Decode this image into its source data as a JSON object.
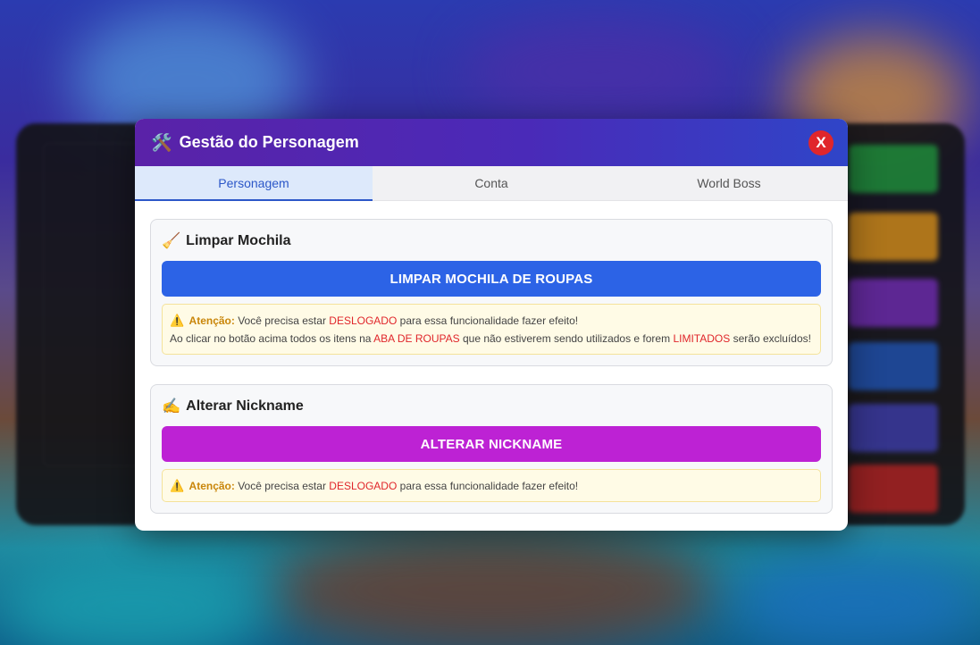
{
  "modal": {
    "title": "Gestão do Personagem",
    "title_icon": "tools-icon",
    "close_label": "X"
  },
  "tabs": [
    {
      "label": "Personagem",
      "active": true
    },
    {
      "label": "Conta",
      "active": false
    },
    {
      "label": "World Boss",
      "active": false
    }
  ],
  "sections": {
    "mochila": {
      "title": "Limpar Mochila",
      "icon": "broom-icon",
      "button": "LIMPAR MOCHILA DE ROUPAS",
      "warning": {
        "label": "Atenção:",
        "line1_a": "Você precisa estar",
        "line1_hl": "DESLOGADO",
        "line1_b": "para essa funcionalidade fazer efeito!",
        "line2_a": "Ao clicar no botão acima todos os itens na",
        "line2_hl1": "ABA DE ROUPAS",
        "line2_b": "que não estiverem sendo utilizados e forem",
        "line2_hl2": "LIMITADOS",
        "line2_c": "serão excluídos!"
      }
    },
    "nickname": {
      "title": "Alterar Nickname",
      "icon": "writing-hand-icon",
      "button": "ALTERAR NICKNAME",
      "warning": {
        "label": "Atenção:",
        "line1_a": "Você precisa estar",
        "line1_hl": "DESLOGADO",
        "line1_b": "para essa funcionalidade fazer efeito!"
      }
    }
  },
  "colors": {
    "header_start": "#5a22a8",
    "header_end": "#2f45c8",
    "primary_button": "#2c63e6",
    "nickname_button": "#bd22d4",
    "close_button": "#e0262b",
    "highlight": "#e0262b",
    "warning_label": "#c9860a"
  }
}
